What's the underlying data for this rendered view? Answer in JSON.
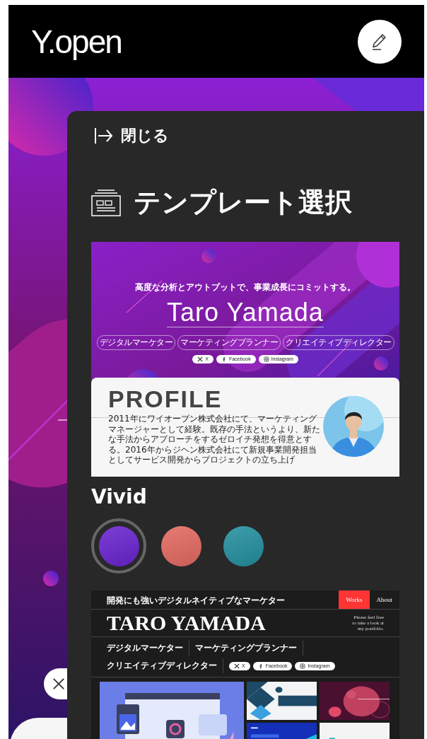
{
  "header": {
    "logo": "Y.open"
  },
  "panel": {
    "close_label": "閉じる",
    "title": "テンプレート選択"
  },
  "templates": [
    {
      "kind": "vivid",
      "name": "Vivid",
      "preview": {
        "tagline": "高度な分析とアウトプットで、事業成長にコミットする。",
        "title": "Taro Yamada",
        "roles": [
          "デジタルマーケター",
          "マーケティングプランナー",
          "クリエイティブディレクター"
        ],
        "socials": [
          {
            "kind": "x",
            "label": "X"
          },
          {
            "kind": "facebook",
            "label": "Facebook"
          },
          {
            "kind": "instagram",
            "label": "Instagram"
          }
        ],
        "profile_heading": "PROFILE",
        "profile_text": "2011年にワイオープン株式会社にて、マーケティングマネージャーとして経験。既存の手法というより、新たな手法からアプローチをするゼロイチ発想を得意とする。2016年からジヘン株式会社にて新規事業開発担当としてサービス開発からプロジェクトの立ち上げ"
      },
      "color_options": [
        {
          "selected": true,
          "color": "#6a24d0"
        },
        {
          "selected": false,
          "color": "#e46a62"
        },
        {
          "selected": false,
          "color": "#2490a0"
        }
      ]
    },
    {
      "kind": "mono",
      "preview": {
        "catchphrase": "開発にも強いデジタルネイティブなマーケター",
        "nav": [
          {
            "label": "Works",
            "selected": true
          },
          {
            "label": "About",
            "selected": false
          }
        ],
        "title": "TARO YAMADA",
        "note": "Please feel free to take a look at my portfolio.",
        "roles": [
          "デジタルマーケター",
          "マーケティングプランナー",
          "クリエイティブディレクター"
        ],
        "socials": [
          {
            "kind": "x",
            "label": "X"
          },
          {
            "kind": "facebook",
            "label": "Facebook"
          },
          {
            "kind": "instagram",
            "label": "Instagram"
          }
        ]
      }
    }
  ]
}
